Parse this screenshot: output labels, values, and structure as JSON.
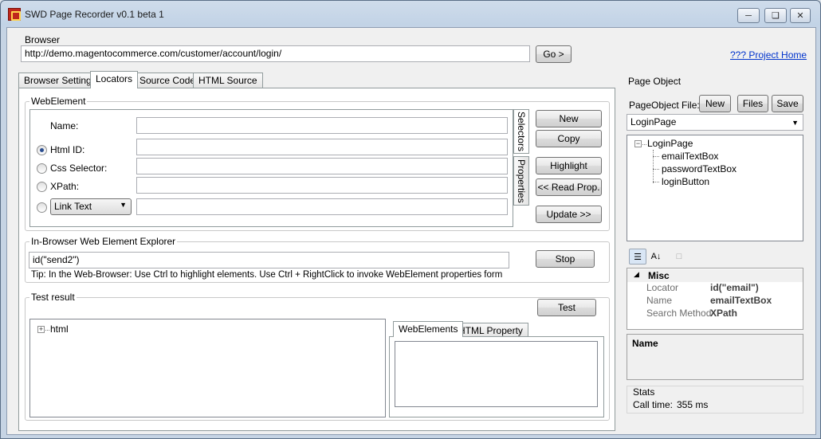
{
  "window": {
    "title": "SWD Page Recorder v0.1 beta 1"
  },
  "browser": {
    "group_label": "Browser",
    "url": "http://demo.magentocommerce.com/customer/account/login/",
    "go_label": "Go >",
    "project_home": "??? Project Home"
  },
  "tabs": [
    "Browser Settings",
    "Locators",
    "Source Code",
    "HTML Source"
  ],
  "webelement": {
    "group_label": "WebElement",
    "name_label": "Name:",
    "html_id_label": "Html ID:",
    "css_label": "Css Selector:",
    "xpath_label": "XPath:",
    "link_text_option": "Link Text",
    "side_tabs": [
      "Selectors",
      "Properties"
    ],
    "buttons": {
      "new": "New",
      "copy": "Copy",
      "highlight": "Highlight",
      "read_prop": "<< Read Prop.",
      "update": "Update >>"
    }
  },
  "explorer": {
    "group_label": "In-Browser Web Element Explorer",
    "value": "id(\"send2\")",
    "stop_label": "Stop",
    "tip": "Tip: In the Web-Browser: Use Ctrl to highlight elements. Use Ctrl + RightClick to invoke WebElement properties form"
  },
  "test_result": {
    "group_label": "Test result",
    "test_label": "Test",
    "tree_root": "html",
    "tabs": [
      "WebElements",
      "HTML Property"
    ]
  },
  "page_object": {
    "group_label": "Page Object",
    "file_label": "PageObject File:",
    "new_label": "New",
    "files_label": "Files",
    "save_label": "Save",
    "selected": "LoginPage",
    "tree": {
      "root": "LoginPage",
      "children": [
        "emailTextBox",
        "passwordTextBox",
        "loginButton"
      ]
    },
    "grid": {
      "category": "Misc",
      "rows": [
        {
          "key": "Locator",
          "value": "id(\"email\")"
        },
        {
          "key": "Name",
          "value": "emailTextBox"
        },
        {
          "key": "Search Method",
          "value": "XPath"
        }
      ]
    },
    "description_title": "Name",
    "stats": {
      "label": "Stats",
      "call_time_label": "Call time:",
      "call_time_value": "355 ms"
    }
  }
}
